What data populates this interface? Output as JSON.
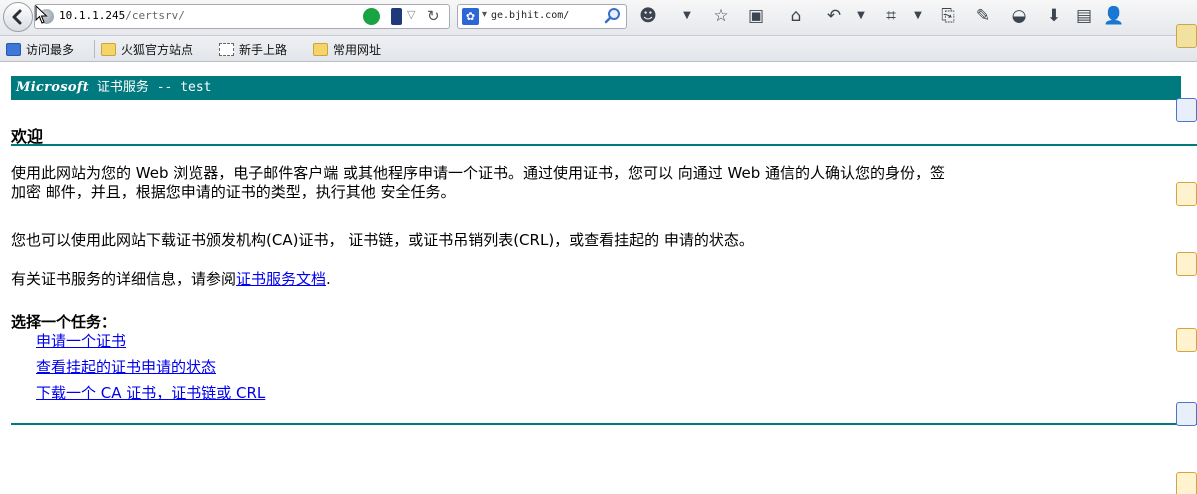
{
  "browser": {
    "url_host": "10.1.1.245",
    "url_path": "/certsrv/",
    "search_text": "ge.bjhit.com/",
    "search_engine_icon": "paw-icon"
  },
  "bookmarks": [
    {
      "label": "访问最多",
      "icon": "most-visited-icon"
    },
    {
      "label": "火狐官方站点",
      "icon": "folder-icon"
    },
    {
      "label": "新手上路",
      "icon": "blank-page-icon"
    },
    {
      "label": "常用网址",
      "icon": "folder-icon"
    }
  ],
  "page": {
    "banner_brand": "Microsoft",
    "banner_rest": " 证书服务 --  test",
    "welcome_heading": "欢迎",
    "para1_line1": "使用此网站为您的 Web 浏览器，电子邮件客户端 或其他程序申请一个证书。通过使用证书，您可以 向通过 Web 通信的人确认您的身份，签",
    "para1_line2": "加密 邮件，并且，根据您申请的证书的类型，执行其他 安全任务。",
    "para2": "您也可以使用此网站下载证书颁发机构(CA)证书， 证书链，或证书吊销列表(CRL)，或查看挂起的 申请的状态。",
    "para3_prefix": "有关证书服务的详细信息，请参阅",
    "para3_link": "证书服务文档",
    "para3_suffix": ".",
    "task_title": "选择一个任务：",
    "tasks": [
      "申请一个证书",
      "查看挂起的证书申请的状态",
      "下载一个 CA 证书，证书链或 CRL"
    ]
  },
  "colors": {
    "banner": "#00797f",
    "link": "#0000ee"
  }
}
